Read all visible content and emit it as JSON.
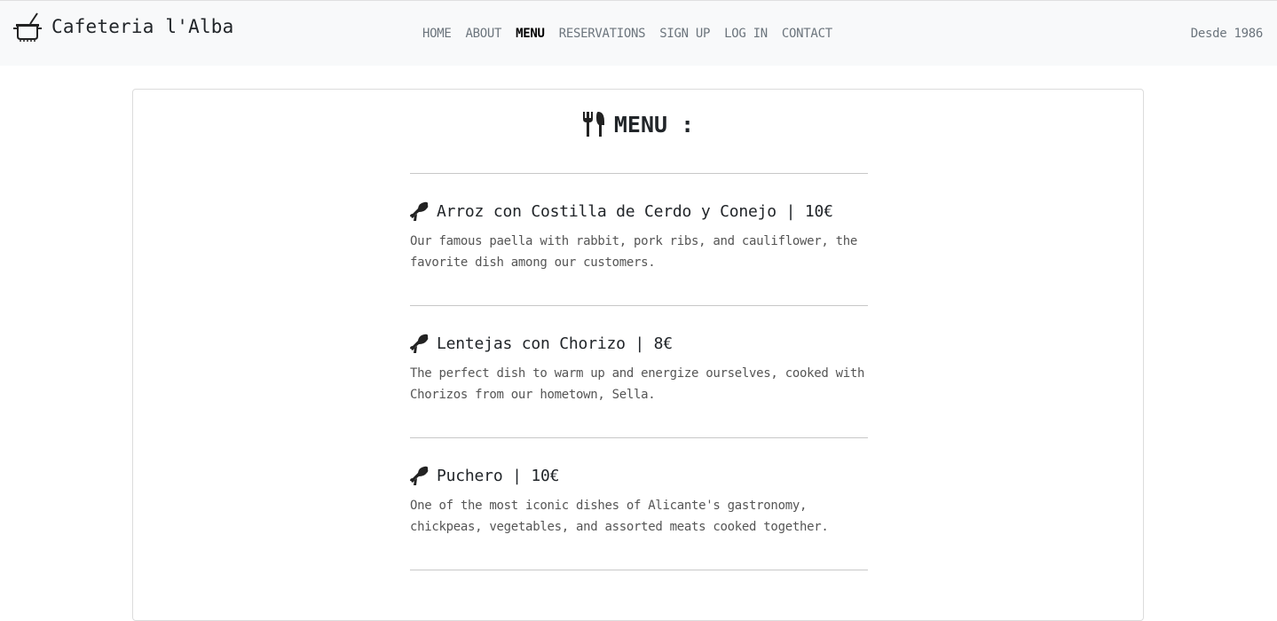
{
  "navbar": {
    "brand": "Cafeteria l'Alba",
    "brand_icon": "cooking-pot-icon",
    "links": [
      {
        "label": "HOME"
      },
      {
        "label": "ABOUT"
      },
      {
        "label": "MENU",
        "active": true
      },
      {
        "label": "RESERVATIONS"
      },
      {
        "label": "SIGN UP"
      },
      {
        "label": "LOG IN"
      },
      {
        "label": "CONTACT"
      }
    ],
    "tagline": "Desde 1986"
  },
  "menu": {
    "title": "MENU :",
    "title_icon": "utensils-icon",
    "dishes": [
      {
        "name": "Arroz con Costilla de Cerdo y Conejo | 10€",
        "icon": "drumstick-icon",
        "description": "Our famous paella with rabbit, pork ribs, and cauliflower, the favorite dish among our customers."
      },
      {
        "name": "Lentejas con Chorizo | 8€",
        "icon": "drumstick-icon",
        "description": "The perfect dish to warm up and energize ourselves, cooked with Chorizos from our hometown, Sella."
      },
      {
        "name": "Puchero | 10€",
        "icon": "drumstick-icon",
        "description": "One of the most iconic dishes of Alicante's gastronomy, chickpeas, vegetables, and assorted meats cooked together."
      }
    ]
  }
}
